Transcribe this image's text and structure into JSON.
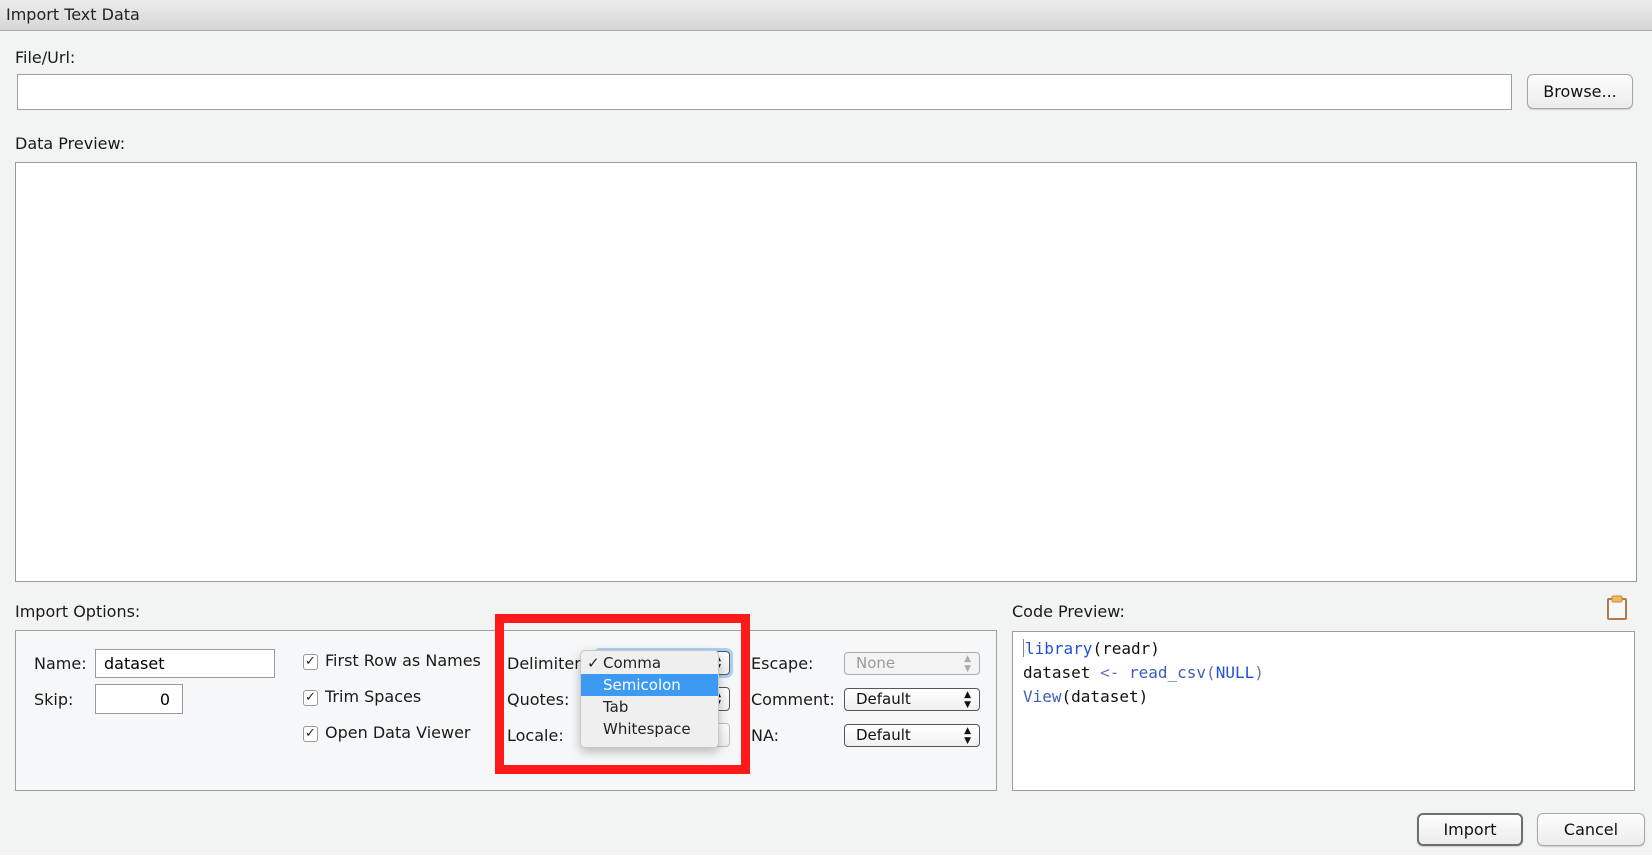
{
  "window": {
    "title": "Import Text Data"
  },
  "file_url": {
    "label": "File/Url:",
    "value": "",
    "browse_label": "Browse..."
  },
  "data_preview": {
    "label": "Data Preview:"
  },
  "import_options": {
    "label": "Import Options:",
    "name_label": "Name:",
    "name_value": "dataset",
    "skip_label": "Skip:",
    "skip_value": "0",
    "checkboxes": [
      {
        "label": "First Row as Names",
        "checked": true
      },
      {
        "label": "Trim Spaces",
        "checked": true
      },
      {
        "label": "Open Data Viewer",
        "checked": true
      }
    ],
    "delimiter_label": "Delimiter:",
    "quotes_label": "Quotes:",
    "locale_label": "Locale:",
    "escape_label": "Escape:",
    "escape_value": "None",
    "comment_label": "Comment:",
    "comment_value": "Default",
    "na_label": "NA:",
    "na_value": "Default"
  },
  "delimiter_dropdown": {
    "selected": "Comma",
    "highlighted": "Semicolon",
    "options": [
      "Comma",
      "Semicolon",
      "Tab",
      "Whitespace"
    ],
    "check_glyph": "✓"
  },
  "code_preview": {
    "label": "Code Preview:",
    "lines": [
      {
        "kw": "library",
        "rest": "(readr)"
      },
      {
        "var": "dataset",
        "op": "<-",
        "fn": "read_csv",
        "open": "(",
        "arg": "NULL",
        "close": ")"
      },
      {
        "fn": "View",
        "rest": "(dataset)"
      }
    ]
  },
  "footer": {
    "import_label": "Import",
    "cancel_label": "Cancel"
  },
  "colors": {
    "highlight": "#3d9af2",
    "annotation_box": "#ff1a1a",
    "keyword": "#1f52d6"
  }
}
